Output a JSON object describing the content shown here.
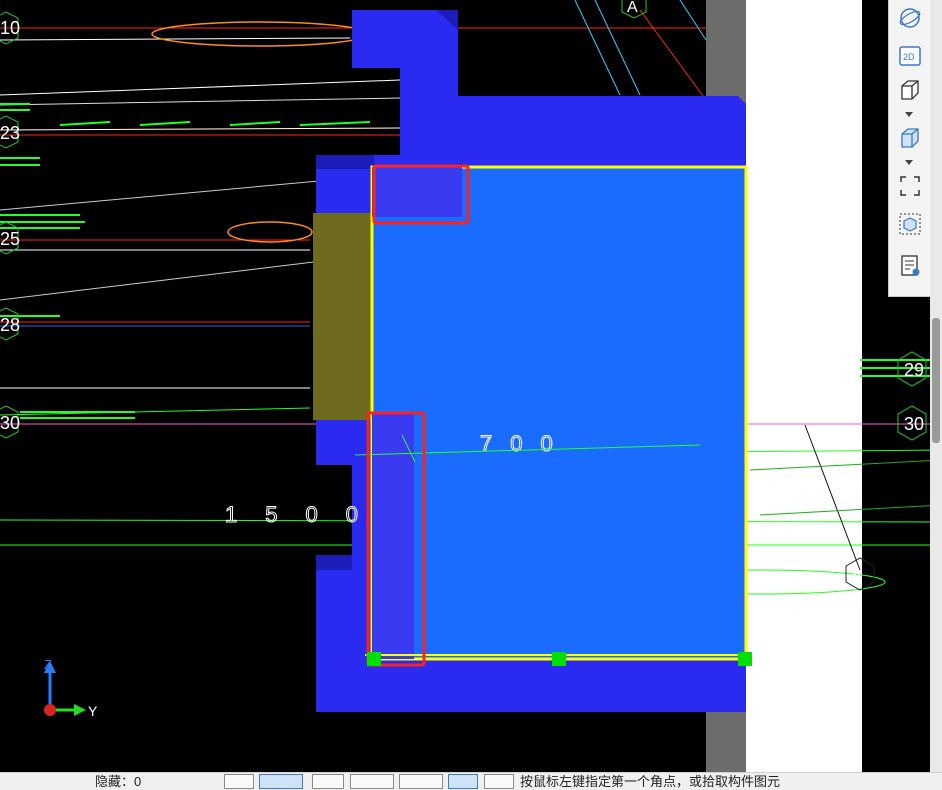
{
  "viewport": {
    "axis_labels_left": [
      "10",
      "23",
      "25",
      "28",
      "30"
    ],
    "axis_labels_right": [
      "29",
      "30"
    ],
    "grid_bubble_labels": [
      "A",
      "A"
    ],
    "dimension_texts": [
      "700",
      "1500"
    ],
    "axis_indicator": {
      "z_label": "Z",
      "y_label": "Y"
    },
    "colors": {
      "background": "#000000",
      "wall_dark_blue": "#2a2af0",
      "slab_blue": "#1a6cff",
      "selection_yellow": "#ffff00",
      "highlight_red": "#ff2020",
      "grip_green": "#00e000",
      "olive_panel": "#6e6a1e"
    }
  },
  "toolbar": {
    "icons": [
      "orbit-icon",
      "view-2d-icon",
      "view-3d-wire-icon",
      "view-3d-solid-icon",
      "fit-view-icon",
      "display-mode-icon",
      "view-properties-icon"
    ],
    "view2d_label": "2D"
  },
  "statusbar": {
    "left_text": "隐藏：0",
    "prompt": "按鼠标左键指定第一个角点，或拾取构件图元"
  }
}
